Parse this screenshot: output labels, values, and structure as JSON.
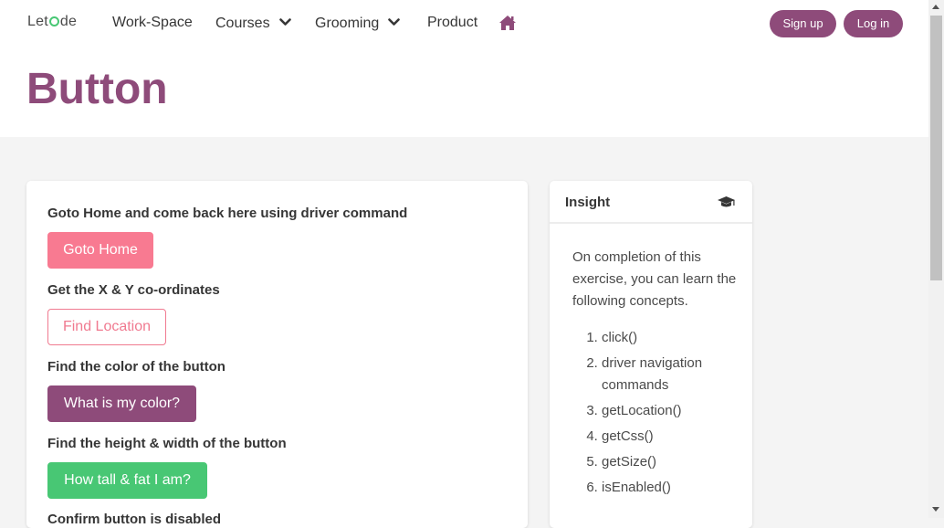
{
  "nav": {
    "logo": {
      "prefix": "Let",
      "suffix": "de"
    },
    "items": [
      {
        "label": "Work-Space"
      },
      {
        "label": "Courses"
      },
      {
        "label": "Grooming"
      },
      {
        "label": "Product"
      }
    ],
    "signup_label": "Sign up",
    "login_label": "Log in"
  },
  "page": {
    "title": "Button"
  },
  "exercises": [
    {
      "question": "Goto Home and come back here using driver command",
      "button": "Goto Home"
    },
    {
      "question": "Get the X & Y co-ordinates",
      "button": "Find Location"
    },
    {
      "question": "Find the color of the button",
      "button": "What is my color?"
    },
    {
      "question": "Find the height & width of the button",
      "button": "How tall & fat I am?"
    },
    {
      "question": "Confirm button is disabled"
    }
  ],
  "insight": {
    "title": "Insight",
    "intro": "On completion of this exercise, you can learn the following concepts.",
    "concepts": [
      "click()",
      "driver navigation commands",
      "getLocation()",
      "getCss()",
      "getSize()",
      "isEnabled()"
    ]
  },
  "icons": {
    "home": "home-icon",
    "cap": "graduation-cap-icon",
    "chevron": "chevron-down-icon"
  },
  "colors": {
    "brand": "#8e4b7a",
    "pink": "#f87a91",
    "green": "#48c774"
  }
}
